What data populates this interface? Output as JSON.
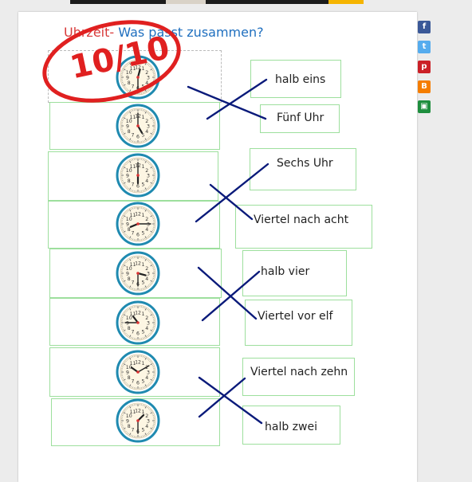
{
  "title": {
    "part1": "Uhrzeit-",
    "part2": "Was passt zusammen?"
  },
  "score": "10/10",
  "clocks": [
    {
      "hour": 12.5,
      "minute": 30,
      "numbers": [
        "12",
        "1",
        "2",
        "3",
        "4",
        "5",
        "6",
        "7",
        "8",
        "9",
        "10",
        "11"
      ]
    },
    {
      "hour": 5.0,
      "minute": 0
    },
    {
      "hour": 6.0,
      "minute": 0
    },
    {
      "hour": 8.25,
      "minute": 15
    },
    {
      "hour": 3.5,
      "minute": 30
    },
    {
      "hour": 10.75,
      "minute": 45
    },
    {
      "hour": 10.17,
      "minute": 10
    },
    {
      "hour": 1.5,
      "minute": 30
    }
  ],
  "labels": [
    "halb eins",
    "Fünf Uhr",
    "Sechs Uhr",
    "Viertel nach acht",
    "halb vier",
    "Viertel vor elf",
    "Viertel nach zehn",
    "halb zwei"
  ],
  "social": [
    {
      "name": "facebook-icon",
      "glyph": "f",
      "color": "#3b5998"
    },
    {
      "name": "twitter-icon",
      "glyph": "t",
      "color": "#55acee"
    },
    {
      "name": "pinterest-icon",
      "glyph": "p",
      "color": "#cb2027"
    },
    {
      "name": "blogger-icon",
      "glyph": "B",
      "color": "#f57d00"
    },
    {
      "name": "classroom-icon",
      "glyph": "▣",
      "color": "#1e8e3e"
    }
  ],
  "colors": {
    "accent_red": "#e02020",
    "title_blue": "#1f6fbf",
    "cross_navy": "#0a1a7a",
    "box_green": "#9ddf9d",
    "clock_rim": "#1f8ab0"
  }
}
